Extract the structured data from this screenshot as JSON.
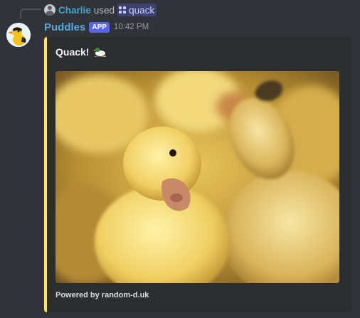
{
  "reply": {
    "user": "Charlie",
    "verb": "used",
    "command": "quack"
  },
  "message": {
    "author": "Puddles",
    "badge": "APP",
    "timestamp": "10:42 PM"
  },
  "embed": {
    "title": "Quack!",
    "footer": "Powered by random-d.uk",
    "accent_color": "#fee75c",
    "title_emoji": "duck-emoji",
    "image": "ducklings-photo"
  },
  "colors": {
    "background": "#313338",
    "embed_background": "#2b2d31",
    "author": "#56a8db",
    "reply_user": "#3fa7c9",
    "app_badge": "#5865f2"
  }
}
